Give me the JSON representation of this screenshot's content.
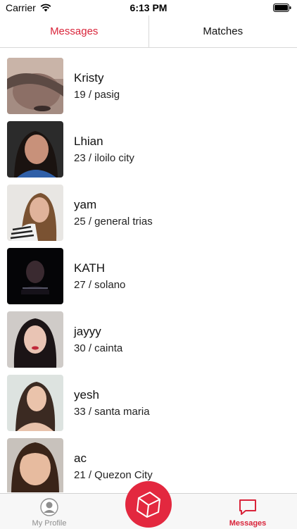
{
  "status_bar": {
    "carrier": "Carrier",
    "time": "6:13 PM"
  },
  "segments": [
    {
      "label": "Messages",
      "active": true
    },
    {
      "label": "Matches",
      "active": false
    }
  ],
  "contacts": [
    {
      "name": "Kristy",
      "detail": "19 / pasig"
    },
    {
      "name": "Lhian",
      "detail": "23 / iloilo city"
    },
    {
      "name": "yam",
      "detail": "25 / general trias"
    },
    {
      "name": "KATH",
      "detail": "27 / solano"
    },
    {
      "name": "jayyy",
      "detail": "30 / cainta"
    },
    {
      "name": "yesh",
      "detail": "33 / santa maria"
    },
    {
      "name": "ac",
      "detail": "21 / Quezon City"
    }
  ],
  "tab_bar": {
    "left": {
      "label": "My Profile",
      "icon": "profile-icon"
    },
    "center": {
      "icon": "cube-icon"
    },
    "right": {
      "label": "Messages",
      "icon": "chat-bubble-icon",
      "active": true
    }
  },
  "colors": {
    "accent": "#d9243a",
    "button": "#e3283f",
    "inactive": "#8e8e8e"
  }
}
